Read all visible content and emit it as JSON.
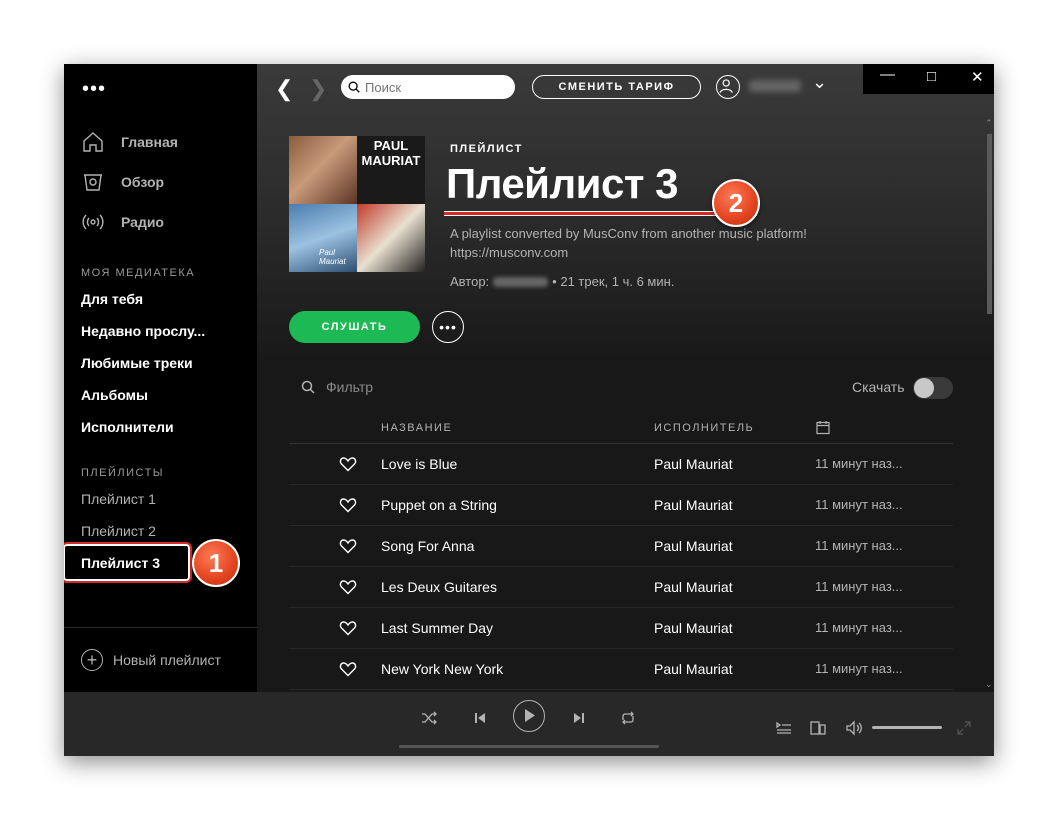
{
  "sidebar": {
    "menu_dots": "•••",
    "nav": [
      {
        "label": "Главная",
        "icon": "home-icon"
      },
      {
        "label": "Обзор",
        "icon": "browse-icon"
      },
      {
        "label": "Радио",
        "icon": "radio-icon"
      }
    ],
    "library_title": "МОЯ МЕДИАТЕКА",
    "library": [
      "Для тебя",
      "Недавно прослу...",
      "Любимые треки",
      "Альбомы",
      "Исполнители"
    ],
    "playlists_title": "ПЛЕЙЛИСТЫ",
    "playlists": [
      "Плейлист 1",
      "Плейлист 2",
      "Плейлист 3"
    ],
    "new_playlist": "Новый плейлист"
  },
  "topbar": {
    "search_placeholder": "Поиск",
    "upgrade_label": "СМЕНИТЬ ТАРИФ"
  },
  "header": {
    "type_label": "ПЛЕЙЛИСТ",
    "title": "Плейлист 3",
    "description": "A playlist converted by MusConv from another music platform! https://musconv.com",
    "author_label": "Автор:",
    "stats": "• 21 трек, 1 ч. 6 мин.",
    "play_label": "СЛУШАТЬ",
    "more_label": "•••",
    "cover_text": [
      "PAUL MAURIAT",
      "Paul Mauriat"
    ]
  },
  "filter": {
    "placeholder": "Фильтр",
    "download_label": "Скачать"
  },
  "table": {
    "headers": [
      "НАЗВАНИЕ",
      "ИСПОЛНИТЕЛЬ"
    ],
    "rows": [
      {
        "title": "Love is Blue",
        "artist": "Paul Mauriat",
        "added": "11 минут наз..."
      },
      {
        "title": "Puppet on a String",
        "artist": "Paul Mauriat",
        "added": "11 минут наз..."
      },
      {
        "title": "Song For Anna",
        "artist": "Paul Mauriat",
        "added": "11 минут наз..."
      },
      {
        "title": "Les Deux Guitares",
        "artist": "Paul Mauriat",
        "added": "11 минут наз..."
      },
      {
        "title": "Last Summer Day",
        "artist": "Paul Mauriat",
        "added": "11 минут наз..."
      },
      {
        "title": "New York New York",
        "artist": "Paul Mauriat",
        "added": "11 минут наз..."
      }
    ]
  },
  "annotations": {
    "badge1": "1",
    "badge2": "2"
  },
  "colors": {
    "accent_green": "#1db954",
    "highlight_red": "#d42a2a",
    "badge_orange": "#e2431e"
  }
}
